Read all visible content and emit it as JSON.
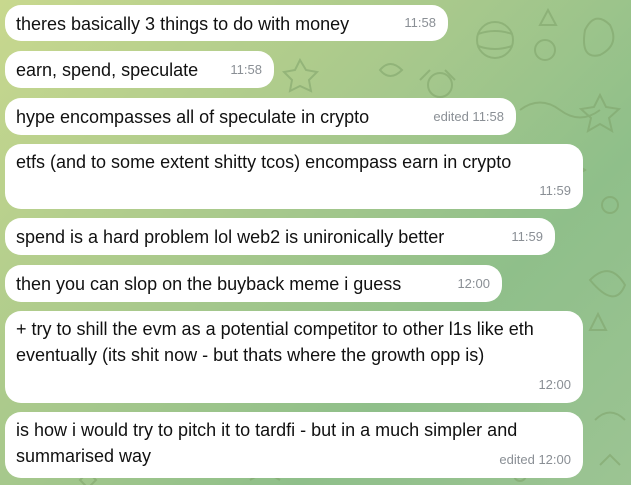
{
  "chat": {
    "messages": [
      {
        "text": "theres basically 3 things to do with money",
        "meta": "11:58"
      },
      {
        "text": "earn, spend, speculate",
        "meta": "11:58"
      },
      {
        "text": "hype encompasses all of speculate in crypto",
        "meta": "edited 11:58"
      },
      {
        "text": "etfs (and to some extent shitty tcos) encompass earn in crypto",
        "meta": "11:59"
      },
      {
        "text": "spend is a hard problem lol web2 is unironically better",
        "meta": "11:59"
      },
      {
        "text": "then you can slop on the buyback meme i guess",
        "meta": "12:00"
      },
      {
        "text": "+ try to shill the evm as a potential competitor to other l1s like eth eventually (its shit now - but thats where the growth opp is)",
        "meta": "12:00"
      },
      {
        "text": "is how i would try to pitch it to tardfi - but in a much simpler and summarised way",
        "meta": "edited 12:00"
      }
    ]
  },
  "colors": {
    "bubble_bg": "#ffffff",
    "text": "#111111",
    "meta_text": "#8a8f95",
    "wallpaper": "#a9c98c"
  }
}
